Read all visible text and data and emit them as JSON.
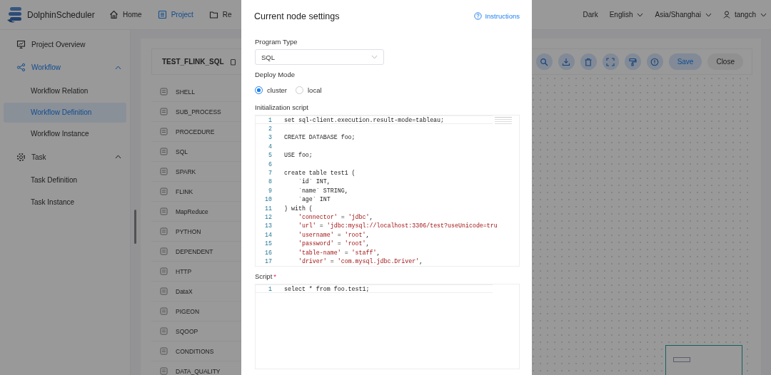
{
  "header": {
    "logo_text": "DolphinScheduler",
    "nav": [
      {
        "label": "Home",
        "selected": false
      },
      {
        "label": "Project",
        "selected": true
      },
      {
        "label": "Re",
        "selected": false
      }
    ],
    "theme": "Dark",
    "language": "English",
    "timezone": "Asia/Shanghai",
    "user": "tangch"
  },
  "sidebar": {
    "items": [
      {
        "label": "Project Overview",
        "active": false
      },
      {
        "label": "Workflow",
        "active": true,
        "expanded": true,
        "children": [
          {
            "label": "Workflow Relation",
            "selected": false
          },
          {
            "label": "Workflow Definition",
            "selected": true
          },
          {
            "label": "Workflow Instance",
            "selected": false
          }
        ]
      },
      {
        "label": "Task",
        "active": false,
        "expanded": true,
        "children": [
          {
            "label": "Task Definition",
            "selected": false
          },
          {
            "label": "Task Instance",
            "selected": false
          }
        ]
      }
    ]
  },
  "workflow": {
    "name": "TEST_FLINK_SQL",
    "tasks": [
      "SHELL",
      "SUB_PROCESS",
      "PROCEDURE",
      "SQL",
      "SPARK",
      "FLINK",
      "MapReduce",
      "PYTHON",
      "DEPENDENT",
      "HTTP",
      "DataX",
      "PIGEON",
      "SQOOP",
      "CONDITIONS",
      "DATA_QUALITY"
    ],
    "buttons": [
      {
        "label": "Save",
        "kind": "primary"
      },
      {
        "label": "Close",
        "kind": "default"
      }
    ]
  },
  "modal": {
    "title": "Current node settings",
    "help_link": "Instructions",
    "program_type": {
      "label": "Program Type",
      "value": "SQL"
    },
    "deploy_mode": {
      "label": "Deploy Mode",
      "options": [
        {
          "label": "cluster",
          "selected": true
        },
        {
          "label": "local",
          "selected": false
        }
      ]
    },
    "init_script": {
      "label": "Initialization script",
      "lines": [
        {
          "n": "1",
          "code": "set sql-client.execution.result-mode=tableau;"
        },
        {
          "n": "2"
        },
        {
          "n": "3",
          "code": "CREATE DATABASE foo;"
        },
        {
          "n": "4"
        },
        {
          "n": "5",
          "code": "USE foo;"
        },
        {
          "n": "6"
        },
        {
          "n": "7",
          "code": "create table test1 ("
        },
        {
          "n": "8",
          "code": "    `id` INT,"
        },
        {
          "n": "9",
          "code": "    `name` STRING,"
        },
        {
          "n": "10",
          "code": "    `age` INT"
        },
        {
          "n": "11",
          "code": ") with ("
        },
        {
          "n": "12",
          "code": "    'connector' = 'jdbc',"
        },
        {
          "n": "13",
          "code": "    'url' = 'jdbc:mysql://localhost:3306/test?useUnicode=tru"
        },
        {
          "n": "14",
          "code": "    'username' = 'root',"
        },
        {
          "n": "15",
          "code": "    'password' = 'root',"
        },
        {
          "n": "16",
          "code": "    'table-name' = 'staff',"
        },
        {
          "n": "17",
          "code": "    'driver' = 'com.mysql.jdbc.Driver',"
        }
      ]
    },
    "script": {
      "label": "Script",
      "required_mark": "*",
      "lines": [
        {
          "n": "1",
          "code": "select * from foo.test1;"
        }
      ]
    }
  }
}
